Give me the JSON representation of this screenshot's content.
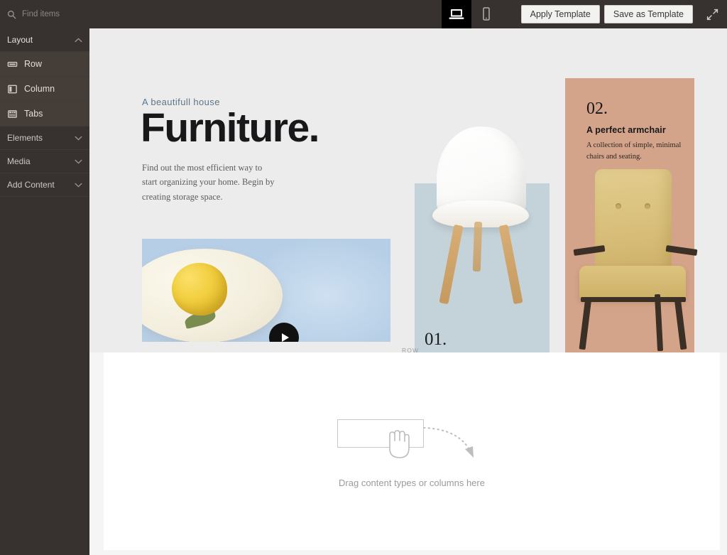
{
  "search": {
    "placeholder": "Find items",
    "value": "",
    "icon": "search-icon"
  },
  "toolbar": {
    "devices": [
      {
        "name": "desktop",
        "icon": "desktop-icon",
        "active": true
      },
      {
        "name": "mobile",
        "icon": "mobile-icon",
        "active": false
      }
    ],
    "apply_template_label": "Apply Template",
    "save_template_label": "Save as Template",
    "expand_icon": "expand-arrows-icon"
  },
  "sidebar": {
    "groups": [
      {
        "label": "Layout",
        "expanded": true,
        "chevron": "chevron-up-icon"
      },
      {
        "label": "Elements",
        "expanded": false,
        "chevron": "chevron-down-icon"
      },
      {
        "label": "Media",
        "expanded": false,
        "chevron": "chevron-down-icon"
      },
      {
        "label": "Add Content",
        "expanded": false,
        "chevron": "chevron-down-icon"
      }
    ],
    "layout_items": [
      {
        "label": "Row",
        "icon": "row-icon"
      },
      {
        "label": "Column",
        "icon": "column-icon"
      },
      {
        "label": "Tabs",
        "icon": "tabs-icon"
      }
    ]
  },
  "canvas": {
    "hero": {
      "eyebrow": "A beautifull house",
      "title": "Furniture.",
      "paragraph": "Find out the most efficient way to start organizing your home. Begin by creating storage space."
    },
    "media_block": {
      "name": "lemon-video",
      "play_icon": "play-icon"
    },
    "cards": [
      {
        "number": "01.",
        "heading": "",
        "body": "",
        "accent": "#c4d2d9"
      },
      {
        "number": "02.",
        "heading": "A perfect armchair",
        "body": "A collection of simple, minimal chairs and seating.",
        "accent": "#d4a48a"
      }
    ],
    "row_label": "ROW",
    "dropzone": {
      "text": "Drag content types or columns here",
      "hand_icon": "hand-drag-icon",
      "arrow_icon": "curved-arrow-icon"
    }
  },
  "colors": {
    "chrome": "#37322f",
    "chrome_item": "#443d38",
    "canvas_bg": "#f5f5f5",
    "hero_bg": "#ececec",
    "card_blue": "#c4d2d9",
    "card_terracotta": "#d4a48a",
    "active_device": "#000000"
  }
}
